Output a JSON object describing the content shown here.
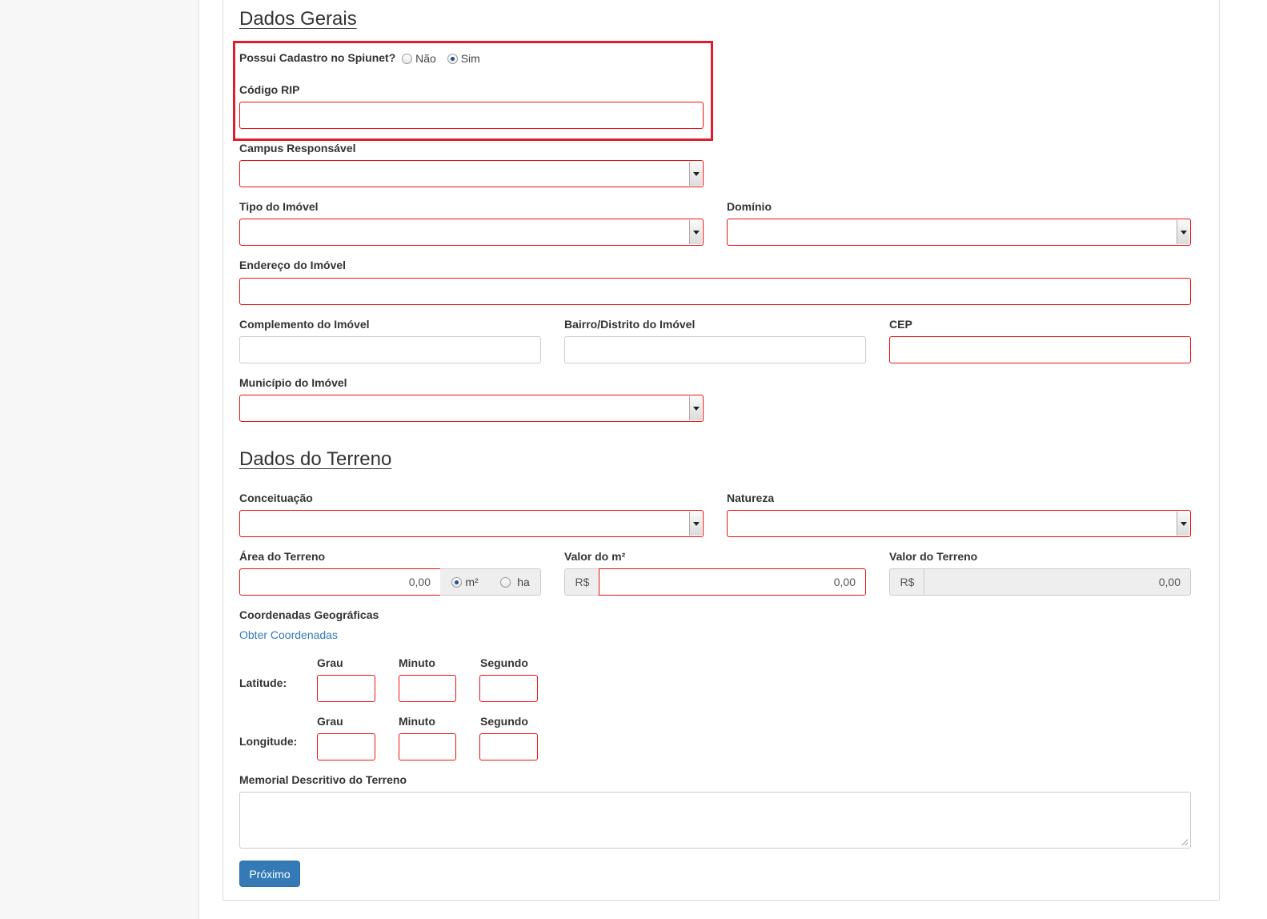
{
  "dados_gerais": {
    "title": "Dados Gerais",
    "spiunet": {
      "label": "Possui Cadastro no Spiunet?",
      "options": [
        {
          "label": "Não",
          "checked": false
        },
        {
          "label": "Sim",
          "checked": true
        }
      ]
    },
    "codigo_rip": {
      "label": "Código RIP",
      "value": ""
    },
    "campus": {
      "label": "Campus Responsável",
      "value": ""
    },
    "tipo_imovel": {
      "label": "Tipo do Imóvel",
      "value": ""
    },
    "dominio": {
      "label": "Domínio",
      "value": ""
    },
    "endereco": {
      "label": "Endereço do Imóvel",
      "value": ""
    },
    "complemento": {
      "label": "Complemento do Imóvel",
      "value": ""
    },
    "bairro": {
      "label": "Bairro/Distrito do Imóvel",
      "value": ""
    },
    "cep": {
      "label": "CEP",
      "value": ""
    },
    "municipio": {
      "label": "Município do Imóvel",
      "value": ""
    }
  },
  "dados_terreno": {
    "title": "Dados do Terreno",
    "conceituacao": {
      "label": "Conceituação",
      "value": ""
    },
    "natureza": {
      "label": "Natureza",
      "value": ""
    },
    "area": {
      "label": "Área do Terreno",
      "value": "0,00",
      "units": [
        {
          "label": "m²",
          "checked": true
        },
        {
          "label": "ha",
          "checked": false
        }
      ]
    },
    "valor_m2": {
      "label": "Valor do m²",
      "prefix": "R$",
      "value": "0,00"
    },
    "valor_terreno": {
      "label": "Valor do Terreno",
      "prefix": "R$",
      "value": "0,00"
    },
    "coordenadas": {
      "label": "Coordenadas Geográficas",
      "link": "Obter Coordenadas",
      "latitude": {
        "label": "Latitude:",
        "cols": [
          "Grau",
          "Minuto",
          "Segundo"
        ]
      },
      "longitude": {
        "label": "Longitude:",
        "cols": [
          "Grau",
          "Minuto",
          "Segundo"
        ]
      }
    },
    "memorial": {
      "label": "Memorial Descritivo do Terreno",
      "value": ""
    }
  },
  "actions": {
    "next_label": "Próximo"
  },
  "colors": {
    "required_border": "#ee1111",
    "highlight": "#e01e2b",
    "primary": "#337ab7"
  }
}
